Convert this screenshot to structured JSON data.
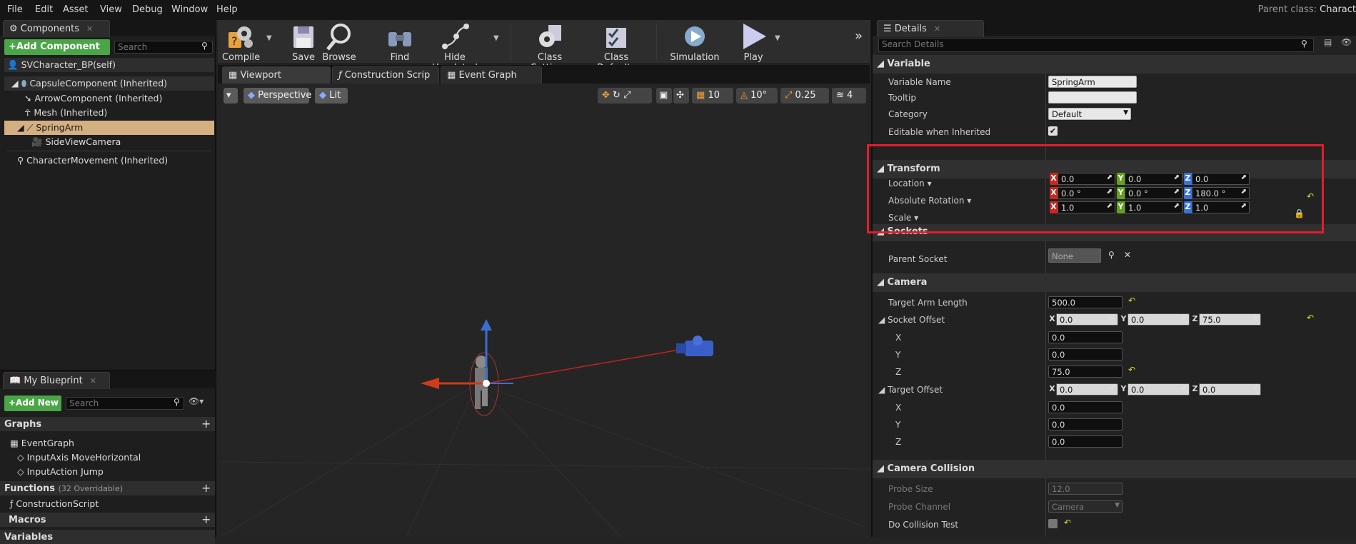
{
  "menu": [
    "File",
    "Edit",
    "Asset",
    "View",
    "Debug",
    "Window",
    "Help"
  ],
  "parent_class": {
    "label": "Parent class:",
    "value": "Charact"
  },
  "components": {
    "tab_label": "Components",
    "add_button": "+Add Component",
    "search_placeholder": "Search",
    "self_item": "SVCharacter_BP(self)",
    "items": [
      "CapsuleComponent (Inherited)",
      "ArrowComponent (Inherited)",
      "Mesh (Inherited)",
      "SpringArm",
      "SideViewCamera",
      "CharacterMovement (Inherited)"
    ]
  },
  "toolbar": {
    "buttons": [
      "Compile",
      "Save",
      "Browse",
      "Find",
      "Hide Unrelated",
      "Class Settings",
      "Class Defaults",
      "Simulation",
      "Play"
    ]
  },
  "editor_tabs": [
    "Viewport",
    "Construction Scrip",
    "Event Graph"
  ],
  "viewport": {
    "perspective": "Perspective",
    "lit": "Lit",
    "grid_snap": "10",
    "rot_snap": "10°",
    "scale_snap": "0.25",
    "cam_speed": "4"
  },
  "my_blueprint": {
    "tab_label": "My Blueprint",
    "add_button": "+Add New",
    "search_placeholder": "Search",
    "sections": {
      "graphs": "Graphs",
      "event_graph": "EventGraph",
      "events": [
        "InputAxis MoveHorizontal",
        "InputAction Jump"
      ],
      "functions": "Functions",
      "functions_count": "(32 Overridable)",
      "construction": "ConstructionScript",
      "macros": "Macros",
      "variables": "Variables"
    }
  },
  "details": {
    "tab_label": "Details",
    "search_placeholder": "Search Details",
    "variable": {
      "header": "Variable",
      "name_label": "Variable Name",
      "name_value": "SpringArm",
      "tooltip_label": "Tooltip",
      "tooltip_value": "",
      "category_label": "Category",
      "category_value": "Default",
      "editable_label": "Editable when Inherited"
    },
    "transform": {
      "header": "Transform",
      "location_label": "Location",
      "location": [
        "0.0",
        "0.0",
        "0.0"
      ],
      "rotation_label": "Absolute Rotation",
      "rotation": [
        "0.0 °",
        "0.0 °",
        "180.0 °"
      ],
      "scale_label": "Scale",
      "scale": [
        "1.0",
        "1.0",
        "1.0"
      ]
    },
    "sockets": {
      "header": "Sockets",
      "parent_label": "Parent Socket",
      "parent_value": "None"
    },
    "camera": {
      "header": "Camera",
      "arm_label": "Target Arm Length",
      "arm_value": "500.0",
      "socket_offset_label": "Socket Offset",
      "socket_offset": [
        "0.0",
        "0.0",
        "75.0"
      ],
      "x_label": "X",
      "y_label": "Y",
      "z_label": "Z",
      "socket_x": "0.0",
      "socket_y": "0.0",
      "socket_z": "75.0",
      "target_offset_label": "Target Offset",
      "target_offset": [
        "0.0",
        "0.0",
        "0.0"
      ],
      "target_x": "0.0",
      "target_y": "0.0",
      "target_z": "0.0"
    },
    "collision": {
      "header": "Camera Collision",
      "probe_size_label": "Probe Size",
      "probe_size_value": "12.0",
      "probe_channel_label": "Probe Channel",
      "probe_channel_value": "Camera",
      "do_collision_label": "Do Collision Test"
    }
  },
  "axis_letters": [
    "X",
    "Y",
    "Z"
  ],
  "colors": {
    "highlight": "#e01f2b",
    "selection": "#d4af82",
    "green_button": "#4aa547"
  }
}
